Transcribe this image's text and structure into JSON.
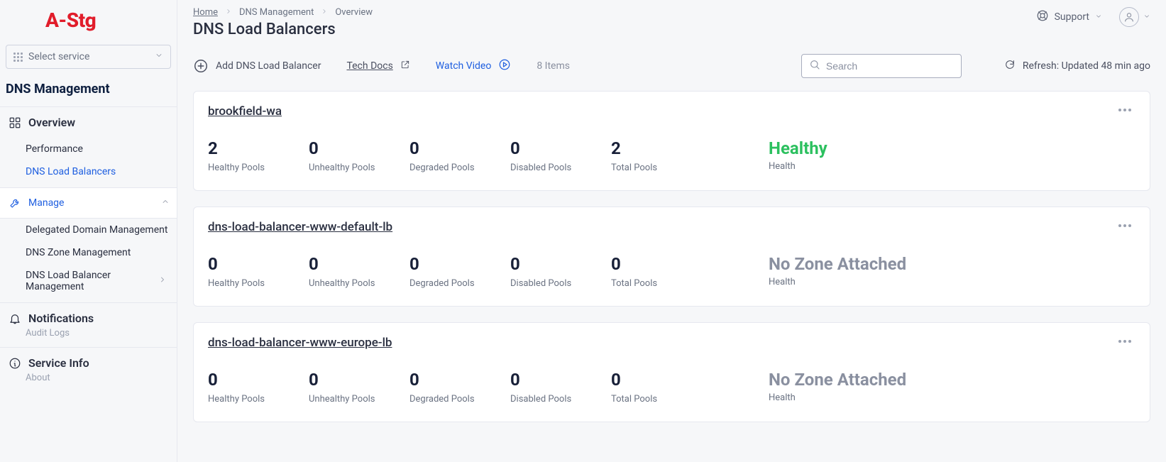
{
  "logo": "A-Stg",
  "sidebar": {
    "select_service": "Select service",
    "section": "DNS Management",
    "overview": "Overview",
    "performance": "Performance",
    "dns_lb": "DNS Load Balancers",
    "manage": "Manage",
    "manage_items": [
      "Delegated Domain Management",
      "DNS Zone Management",
      "DNS Load Balancer Management"
    ],
    "notifications": "Notifications",
    "notifications_sub": "Audit Logs",
    "service_info": "Service Info",
    "service_info_sub": "About"
  },
  "header": {
    "breadcrumbs": [
      "Home",
      "DNS Management",
      "Overview"
    ],
    "title": "DNS Load Balancers",
    "support": "Support"
  },
  "toolbar": {
    "add": "Add DNS Load Balancer",
    "tech_docs": "Tech Docs",
    "watch_video": "Watch Video",
    "item_count": "8 Items",
    "search_placeholder": "Search",
    "refresh": "Refresh: Updated 48 min ago"
  },
  "metrics_labels": {
    "healthy": "Healthy Pools",
    "unhealthy": "Unhealthy Pools",
    "degraded": "Degraded Pools",
    "disabled": "Disabled Pools",
    "total": "Total Pools",
    "health": "Health"
  },
  "cards": [
    {
      "name": "brookfield-wa",
      "healthy": "2",
      "unhealthy": "0",
      "degraded": "0",
      "disabled": "0",
      "total": "2",
      "health_status": "Healthy",
      "health_class": "healthy"
    },
    {
      "name": "dns-load-balancer-www-default-lb",
      "healthy": "0",
      "unhealthy": "0",
      "degraded": "0",
      "disabled": "0",
      "total": "0",
      "health_status": "No Zone Attached",
      "health_class": "nozone"
    },
    {
      "name": "dns-load-balancer-www-europe-lb",
      "healthy": "0",
      "unhealthy": "0",
      "degraded": "0",
      "disabled": "0",
      "total": "0",
      "health_status": "No Zone Attached",
      "health_class": "nozone"
    }
  ]
}
